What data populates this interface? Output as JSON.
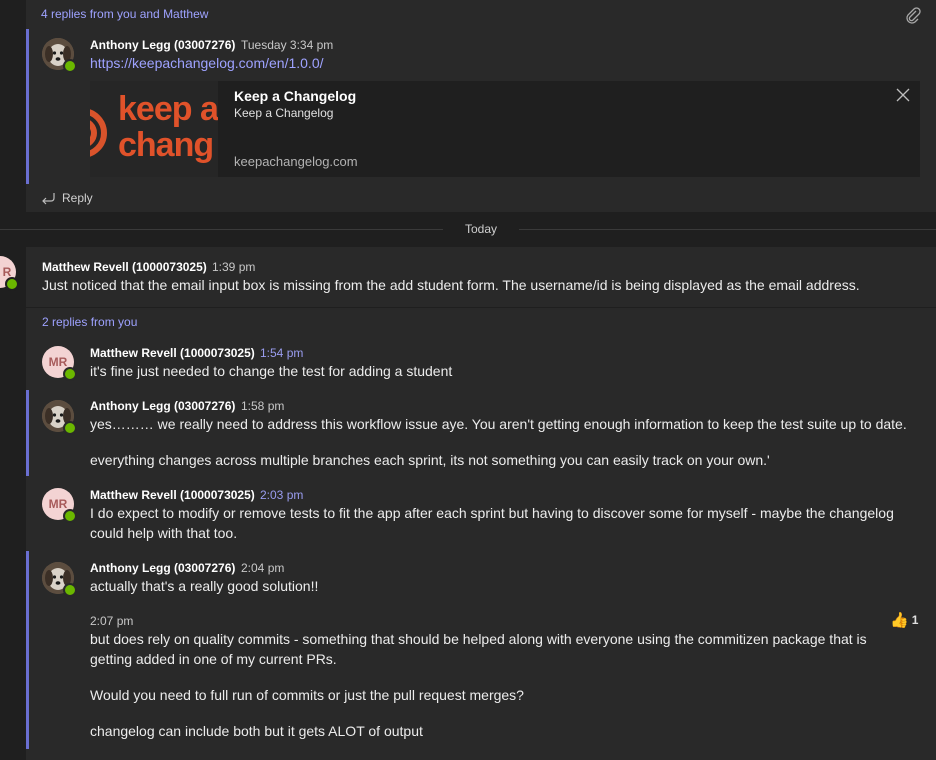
{
  "thread1": {
    "replies_summary": "4 replies from you and Matthew",
    "message": {
      "author": "Anthony Legg (03007276)",
      "time": "Tuesday 3:34 pm",
      "link": "https://keepachangelog.com/en/1.0.0/",
      "preview": {
        "logo_line1": "keep a",
        "logo_line2": "chang",
        "title": "Keep a Changelog",
        "subtitle": "Keep a Changelog",
        "domain": "keepachangelog.com"
      }
    },
    "reply_label": "Reply"
  },
  "date_divider": "Today",
  "thread2": {
    "root": {
      "avatar_partial": "R",
      "author": "Matthew Revell (1000073025)",
      "time": "1:39 pm",
      "text": "Just noticed that the email input box is missing from the add student form. The username/id is being displayed as the email address."
    },
    "replies_summary": "2 replies from you",
    "replies": [
      {
        "avatar": "MR",
        "author": "Matthew Revell (1000073025)",
        "time": "1:54 pm",
        "lines": [
          "it's fine just needed to change the test for adding a student"
        ]
      },
      {
        "author": "Anthony Legg (03007276)",
        "time": "1:58 pm",
        "lines": [
          "yes……… we really need to address this workflow issue aye. You aren't getting enough information to keep the test suite up to date.",
          "everything changes across multiple branches each sprint, its not something you can easily track on your own.'"
        ]
      },
      {
        "avatar": "MR",
        "author": "Matthew Revell (1000073025)",
        "time": "2:03 pm",
        "lines": [
          "I do expect to modify or remove tests to fit the app after each sprint but having to discover some for myself - maybe the changelog could help with that too."
        ]
      },
      {
        "author": "Anthony Legg (03007276)",
        "time": "2:04 pm",
        "lines": [
          "actually that's a really good solution!!"
        ],
        "followup": {
          "time": "2:07 pm",
          "reaction_count": "1",
          "lines": [
            "but does rely on quality commits - something that should be helped along with everyone using the commitizen package that is getting added in one of my current PRs.",
            "Would you need to full run of commits or just the pull request merges?",
            "changelog can include both but it gets ALOT of output"
          ]
        }
      }
    ]
  }
}
